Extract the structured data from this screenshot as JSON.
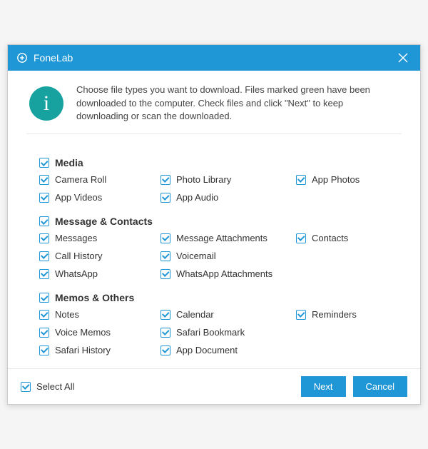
{
  "titlebar": {
    "app_name": "FoneLab"
  },
  "intro": {
    "text": "Choose file types you want to download. Files marked green have been downloaded to the computer. Check files and click \"Next\" to keep downloading or scan the downloaded."
  },
  "sections": [
    {
      "title": "Media",
      "checked": true,
      "items": [
        {
          "label": "Camera Roll",
          "checked": true
        },
        {
          "label": "Photo Library",
          "checked": true
        },
        {
          "label": "App Photos",
          "checked": true
        },
        {
          "label": "App Videos",
          "checked": true
        },
        {
          "label": "App Audio",
          "checked": true
        }
      ]
    },
    {
      "title": "Message & Contacts",
      "checked": true,
      "items": [
        {
          "label": "Messages",
          "checked": true
        },
        {
          "label": "Message Attachments",
          "checked": true
        },
        {
          "label": "Contacts",
          "checked": true
        },
        {
          "label": "Call History",
          "checked": true
        },
        {
          "label": "Voicemail",
          "checked": true
        },
        {
          "label": "",
          "checked": null
        },
        {
          "label": "WhatsApp",
          "checked": true
        },
        {
          "label": "WhatsApp Attachments",
          "checked": true
        }
      ]
    },
    {
      "title": "Memos & Others",
      "checked": true,
      "items": [
        {
          "label": "Notes",
          "checked": true
        },
        {
          "label": "Calendar",
          "checked": true
        },
        {
          "label": "Reminders",
          "checked": true
        },
        {
          "label": "Voice Memos",
          "checked": true
        },
        {
          "label": "Safari Bookmark",
          "checked": true
        },
        {
          "label": "",
          "checked": null
        },
        {
          "label": "Safari History",
          "checked": true
        },
        {
          "label": "App Document",
          "checked": true
        }
      ]
    }
  ],
  "footer": {
    "select_all_label": "Select All",
    "select_all_checked": true,
    "next_label": "Next",
    "cancel_label": "Cancel"
  },
  "colors": {
    "accent": "#1f97d6",
    "info": "#17a2a0"
  }
}
